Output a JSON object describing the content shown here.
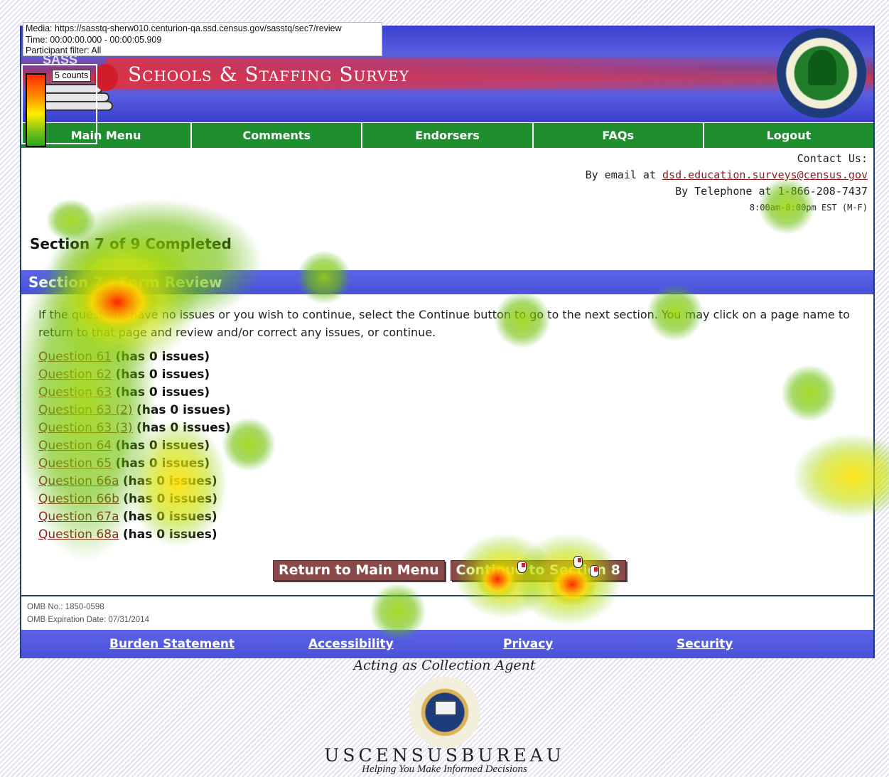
{
  "overlay": {
    "media": "Media: https://sasstq-sherw010.centurion-qa.ssd.census.gov/sasstq/sec7/review",
    "time": "Time: 00:00:00.000 - 00:00:05.909",
    "filter": "Participant filter: All",
    "legend_counts": "5 counts"
  },
  "header": {
    "logo_text": "SASS",
    "title": "Schools & Staffing Survey",
    "seal": "department-of-education-seal"
  },
  "nav": [
    {
      "label": "Main Menu"
    },
    {
      "label": "Comments"
    },
    {
      "label": "Endorsers"
    },
    {
      "label": "FAQs"
    },
    {
      "label": "Logout"
    }
  ],
  "contact": {
    "heading": "Contact Us:",
    "email_prefix": "By email at ",
    "email": "dsd.education.surveys@census.gov",
    "phone_prefix": "By Telephone at ",
    "phone": "1-866-208-7437",
    "hours": "8:00am-8:00pm EST (M-F)"
  },
  "status": {
    "completed": "Section 7 of 9 Completed",
    "section_title": "Section 7 - Form Review"
  },
  "instructions": "If the questions have no issues or you wish to continue, select the Continue button to go to the next section. You may click on a page name to return to that page and review and/or correct any issues, or continue.",
  "questions": [
    {
      "link": "Question 61",
      "issues": "(has 0 issues)"
    },
    {
      "link": "Question 62",
      "issues": "(has 0 issues)"
    },
    {
      "link": "Question 63",
      "issues": "(has 0 issues)"
    },
    {
      "link": "Question 63 (2)",
      "issues": "(has 0 issues)"
    },
    {
      "link": "Question 63 (3)",
      "issues": "(has 0 issues)"
    },
    {
      "link": "Question 64",
      "issues": "(has 0 issues)"
    },
    {
      "link": "Question 65",
      "issues": "(has 0 issues)"
    },
    {
      "link": "Question 66a",
      "issues": "(has 0 issues)"
    },
    {
      "link": "Question 66b",
      "issues": "(has 0 issues)"
    },
    {
      "link": "Question 67a",
      "issues": "(has 0 issues)"
    },
    {
      "link": "Question 68a",
      "issues": "(has 0 issues)"
    }
  ],
  "buttons": {
    "return": "Return to Main Menu",
    "continue": "Continue to Section 8"
  },
  "omb": {
    "number": "OMB No.: 1850-0598",
    "expiration": "OMB Expiration Date: 07/31/2014"
  },
  "footer_links": [
    "Burden Statement",
    "Accessibility",
    "Privacy",
    "Security"
  ],
  "agent": {
    "acting": "Acting as Collection Agent",
    "seal": "census-bureau-seal",
    "name": "USCENSUSBUREAU",
    "tagline": "Helping You Make Informed Decisions"
  },
  "colors": {
    "nav_green": "#1f8e2e",
    "section_blue": "#4a52d8",
    "link_red": "#8b1c1c",
    "button_maroon": "#8b4a4a"
  }
}
